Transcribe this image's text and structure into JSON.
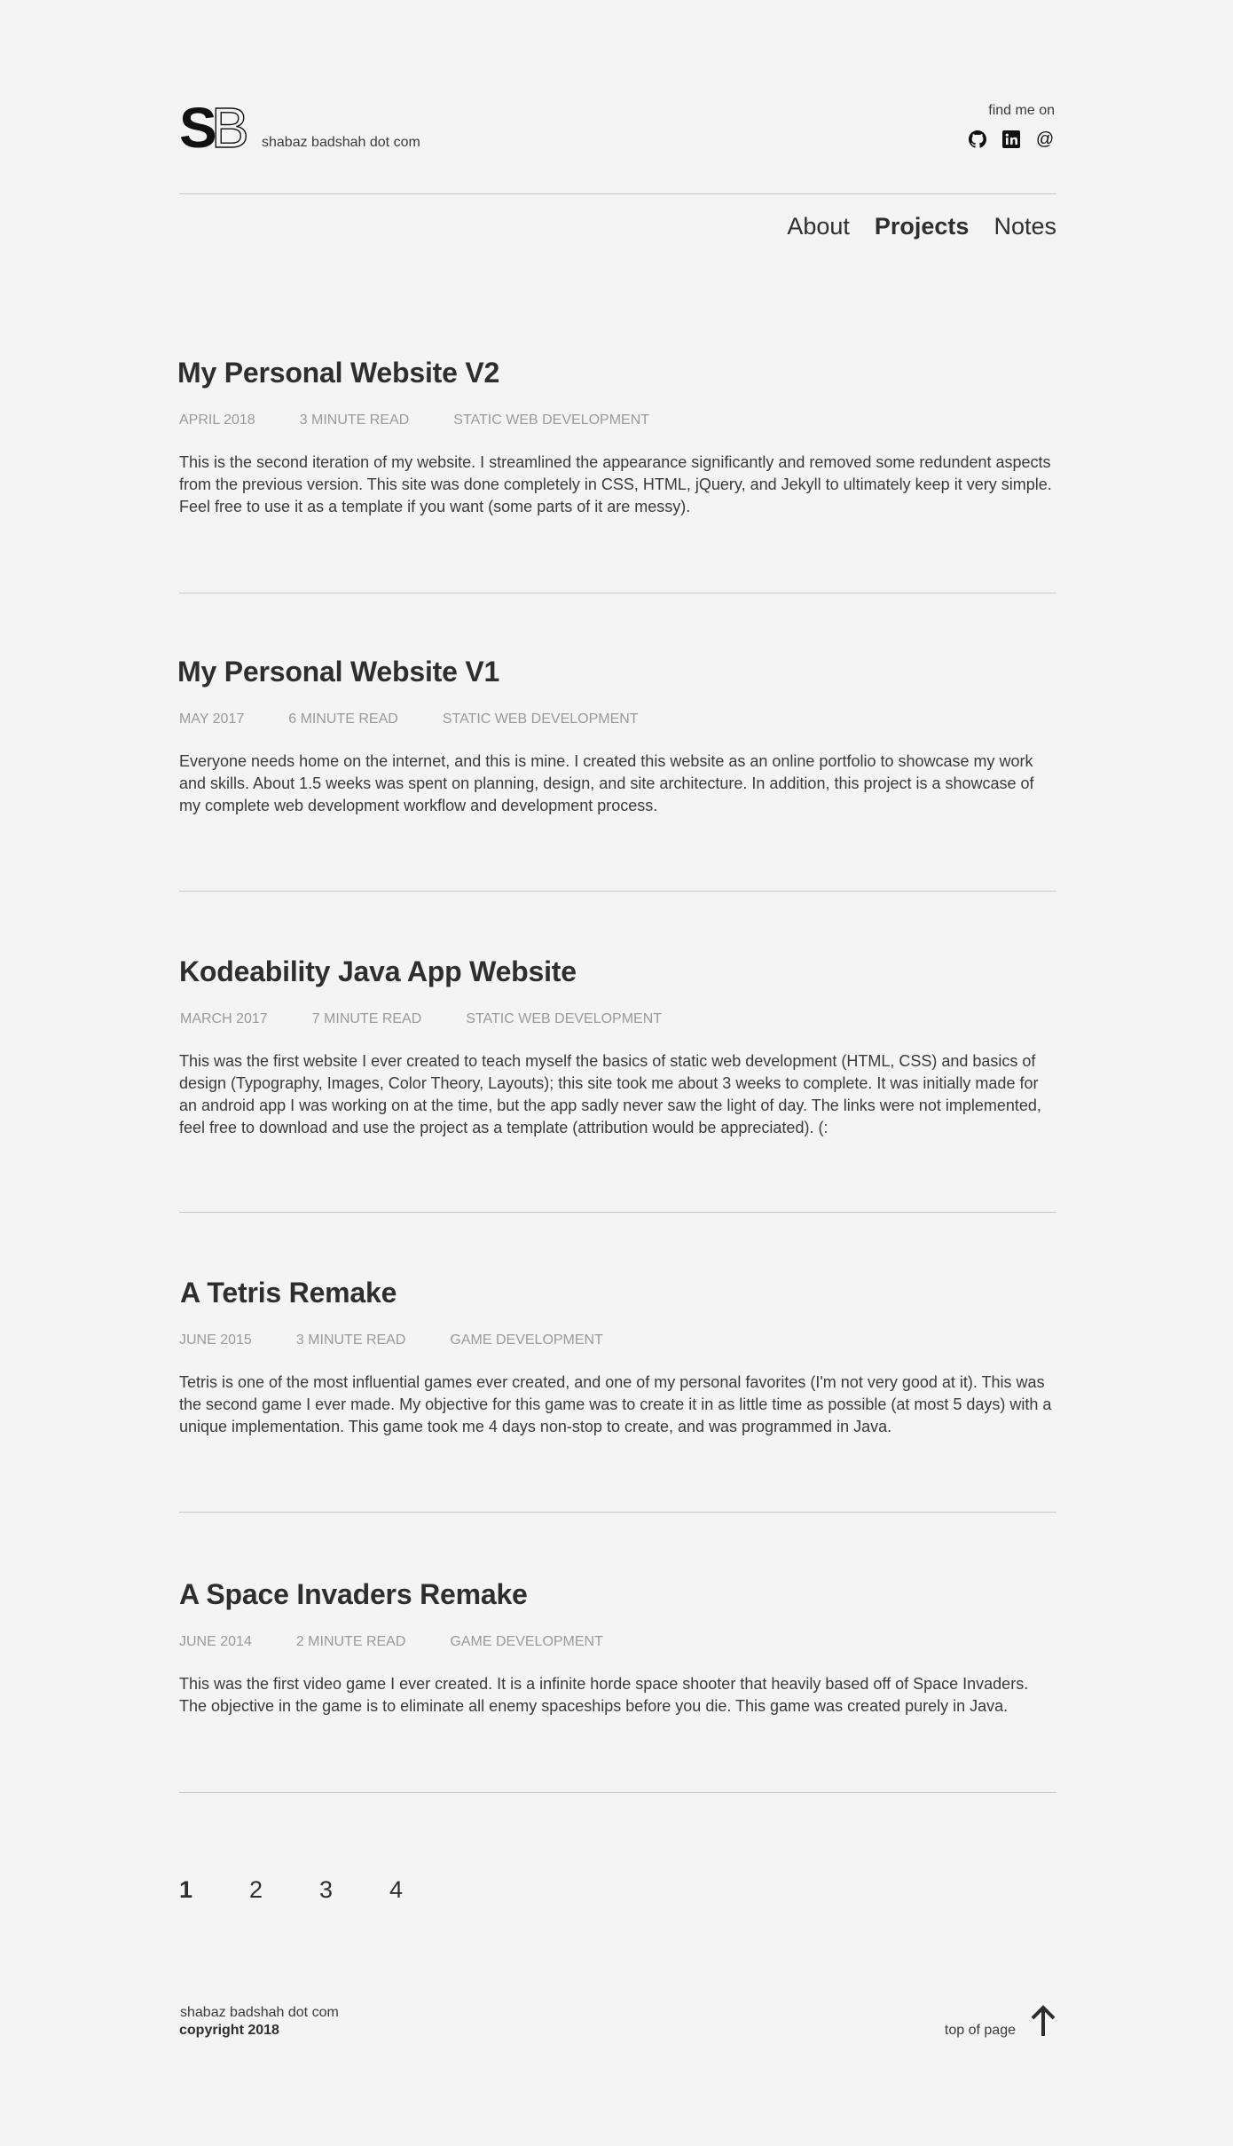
{
  "header": {
    "logo_text": "SB",
    "site_name": "shabaz badshah dot com",
    "find_me_label": "find me on",
    "social": [
      {
        "icon": "github-icon"
      },
      {
        "icon": "linkedin-icon"
      },
      {
        "icon": "email-icon",
        "glyph": "@"
      }
    ]
  },
  "nav": {
    "items": [
      {
        "label": "About",
        "active": false
      },
      {
        "label": "Projects",
        "active": true
      },
      {
        "label": "Notes",
        "active": false
      }
    ]
  },
  "posts": [
    {
      "title": "My Personal Website V2",
      "date": "APRIL 2018",
      "read_time": "3 MINUTE READ",
      "category": "STATIC WEB DEVELOPMENT",
      "excerpt": "This is the second iteration of my website. I streamlined the appearance significantly and removed some redundent aspects from the previous version. This site was done completely in CSS, HTML, jQuery, and Jekyll to ultimately keep it very simple. Feel free to use it as a template if you want (some parts of it are messy)."
    },
    {
      "title": "My Personal Website V1",
      "date": "MAY 2017",
      "read_time": "6 MINUTE READ",
      "category": "STATIC WEB DEVELOPMENT",
      "excerpt": "Everyone needs home on the internet, and this is mine. I created this website as an online portfolio to showcase my work and skills. About 1.5 weeks was spent on planning, design, and site architecture. In addition, this project is a showcase of my complete web development workflow and development process."
    },
    {
      "title": "Kodeability Java App Website",
      "date": "MARCH 2017",
      "read_time": "7 MINUTE READ",
      "category": "STATIC WEB DEVELOPMENT",
      "excerpt": "This was the first website I ever created to teach myself the basics of static web development (HTML, CSS) and basics of design (Typography, Images, Color Theory, Layouts); this site took me about 3 weeks to complete. It was initially made for an android app I was working on at the time, but the app sadly never saw the light of day. The links were not implemented, feel free to download and use the project as a template (attribution would be appreciated). (:"
    },
    {
      "title": "A Tetris Remake",
      "date": "JUNE 2015",
      "read_time": "3 MINUTE READ",
      "category": "GAME DEVELOPMENT",
      "excerpt": "Tetris is one of the most influential games ever created, and one of my personal favorites (I'm not very good at it). This was the second game I ever made. My objective for this game was to create it in as little time as possible (at most 5 days) with a unique implementation. This game took me 4 days non-stop to create, and was programmed in Java."
    },
    {
      "title": "A Space Invaders Remake",
      "date": "JUNE 2014",
      "read_time": "2 MINUTE READ",
      "category": "GAME DEVELOPMENT",
      "excerpt": "This was the first video game I ever created. It is a infinite horde space shooter that heavily based off of Space Invaders. The objective in the game is to eliminate all enemy spaceships before you die. This game was created purely in Java."
    }
  ],
  "pagination": {
    "pages": [
      "1",
      "2",
      "3",
      "4"
    ],
    "current": "1"
  },
  "footer": {
    "site_name": "shabaz badshah dot com",
    "copyright": "copyright 2018",
    "top_link": "top of page",
    "top_icon": "arrow-up-icon"
  },
  "colors": {
    "background": "#f4f4f4",
    "text": "#2e2e2e",
    "meta": "#9a9a9a",
    "rule": "#c8c8c8"
  }
}
